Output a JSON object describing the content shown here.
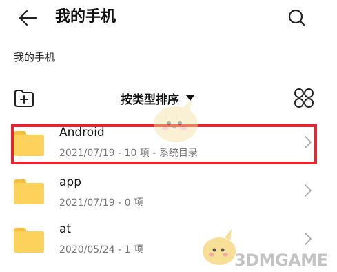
{
  "header": {
    "title": "我的手机"
  },
  "breadcrumb": "我的手机",
  "toolbar": {
    "sort_label": "按类型排序"
  },
  "files": [
    {
      "name": "Android",
      "date": "2021/07/19",
      "count": "10 项",
      "tag": "系统目录",
      "meta": "2021/07/19 - 10 项 - 系统目录"
    },
    {
      "name": "app",
      "date": "2021/07/19",
      "count": "0 项",
      "meta": "2021/07/19 - 0 项"
    },
    {
      "name": "at",
      "date": "2020/05/24",
      "count": "1 项",
      "meta": "2020/05/24 - 1 项"
    }
  ],
  "icons": {
    "back": "back-arrow-icon",
    "search": "search-icon",
    "new_folder": "new-folder-icon",
    "sort_dropdown": "dropdown-triangle-icon",
    "grid_view": "grid-view-icon",
    "folder": "folder-icon",
    "chevron": "chevron-right-icon"
  },
  "colors": {
    "folder": "#fdd25c",
    "folder_tab": "#f7bf3e",
    "highlight": "#e3262f",
    "meta_text": "#777777"
  },
  "watermark": {
    "text": "3DMGAME"
  }
}
